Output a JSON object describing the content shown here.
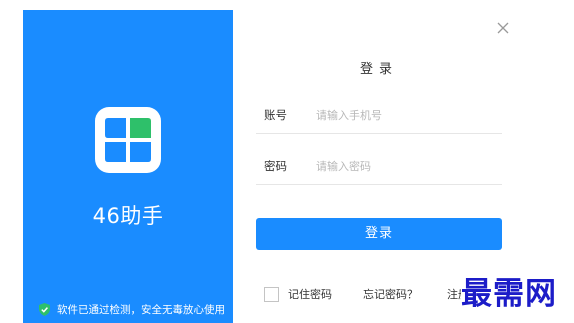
{
  "brand": {
    "app_name": "46助手",
    "security_text": "软件已通过检测，安全无毒放心使用",
    "panel_color": "#1a8cff",
    "logo_icon": "four-petal-windmill-icon"
  },
  "window": {
    "close_icon": "close-icon"
  },
  "form": {
    "title": "登录",
    "account_label": "账号",
    "account_placeholder": "请输入手机号",
    "account_value": "",
    "password_label": "密码",
    "password_placeholder": "请输入密码",
    "password_value": "",
    "login_button": "登录",
    "remember_label": "记住密码",
    "remember_checked": false,
    "forgot_link": "忘记密码？",
    "register_link": "注册账号",
    "accent_color": "#1a8cff"
  },
  "watermark": {
    "text": "最需网",
    "color": "#1c1cc8"
  }
}
